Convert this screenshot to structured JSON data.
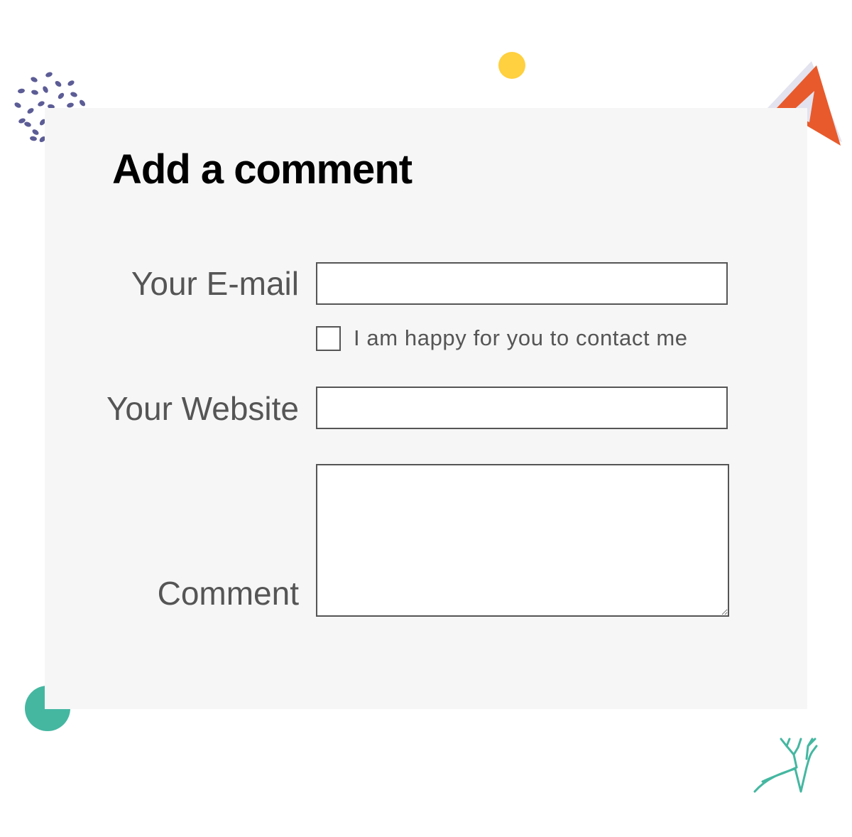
{
  "form": {
    "title": "Add a comment",
    "email_label": "Your E-mail",
    "email_value": "",
    "contact_checkbox_label": "I am happy for you to contact me",
    "contact_checked": false,
    "website_label": "Your Website",
    "website_value": "",
    "comment_label": "Comment",
    "comment_value": ""
  },
  "decorations": {
    "dots_color": "#5c5c96",
    "yellow_dot_color": "#ffd03f",
    "triangle_color": "#e85a2c",
    "triangle_shadow_color": "#e3e3ef",
    "teal_circle_color": "#45b7a1",
    "deer_logo_color": "#45b7a1"
  }
}
